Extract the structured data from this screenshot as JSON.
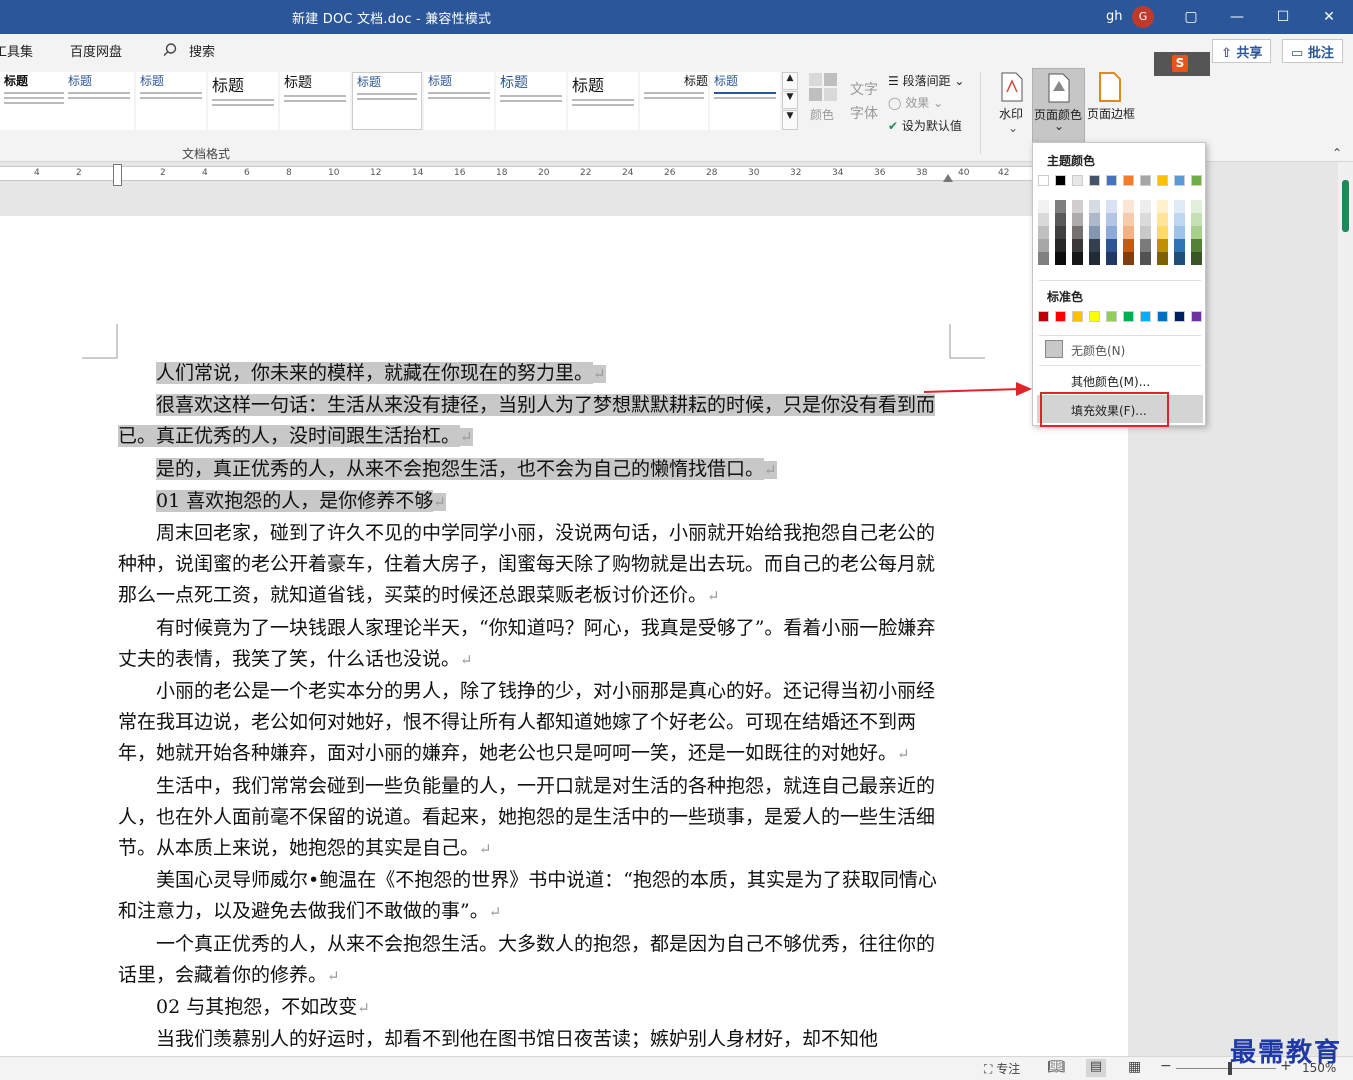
{
  "titlebar": {
    "title": "新建 DOC 文档.doc  -  兼容性模式",
    "user": "gh",
    "avatar_letter": "G",
    "controls": [
      "▢",
      "—",
      "☐",
      "✕"
    ]
  },
  "tabs": [
    "工具集",
    "百度网盘",
    "搜索"
  ],
  "share": {
    "share_label": "共享",
    "comment_label": "批注"
  },
  "ribbon": {
    "gallery": [
      "标题",
      "标题",
      "标题",
      "标题",
      "标题",
      "标题",
      "标题",
      "标题",
      "标题",
      "标题",
      "标题",
      "标题"
    ],
    "group_label": "文档格式",
    "colors_label": "颜色",
    "fonts_label": "文字\n字体",
    "para_spacing": "段落间距",
    "effects": "效果",
    "set_default": "设为默认值",
    "watermark": "水印",
    "page_color": "页面颜色",
    "page_border": "页面边框"
  },
  "ruler": {
    "ticks": [
      "4",
      "2",
      "2",
      "4",
      "6",
      "8",
      "10",
      "12",
      "14",
      "16",
      "18",
      "20",
      "22",
      "24",
      "26",
      "28",
      "30",
      "32",
      "34",
      "36",
      "38",
      "40",
      "42"
    ]
  },
  "document": {
    "paragraphs": [
      {
        "text": "人们常说，你未来的模样，就藏在你现在的努力里。",
        "hl": true
      },
      {
        "text": "很喜欢这样一句话：生活从来没有捷径，当别人为了梦想默默耕耘的时候，只是你没有看到而已。真正优秀的人，没时间跟生活抬杠。",
        "hl": true
      },
      {
        "text": "是的，真正优秀的人，从来不会抱怨生活，也不会为自己的懒惰找借口。",
        "hl": true
      },
      {
        "text": "01  喜欢抱怨的人，是你修养不够",
        "hl": true
      },
      {
        "text": "周末回老家，碰到了许久不见的中学同学小丽，没说两句话，小丽就开始给我抱怨自己老公的种种，说闺蜜的老公开着豪车，住着大房子，闺蜜每天除了购物就是出去玩。而自己的老公每月就那么一点死工资，就知道省钱，买菜的时候还总跟菜贩老板讨价还价。",
        "hl": false
      },
      {
        "text": "有时候竟为了一块钱跟人家理论半天，“你知道吗？阿心，我真是受够了”。看着小丽一脸嫌弃丈夫的表情，我笑了笑，什么话也没说。",
        "hl": false
      },
      {
        "text": "小丽的老公是一个老实本分的男人，除了钱挣的少，对小丽那是真心的好。还记得当初小丽经常在我耳边说，老公如何对她好，恨不得让所有人都知道她嫁了个好老公。可现在结婚还不到两年，她就开始各种嫌弃，面对小丽的嫌弃，她老公也只是呵呵一笑，还是一如既往的对她好。",
        "hl": false
      },
      {
        "text": "生活中，我们常常会碰到一些负能量的人，一开口就是对生活的各种抱怨，就连自己最亲近的人，也在外人面前毫不保留的说道。看起来，她抱怨的是生活中的一些琐事，是爱人的一些生活细节。从本质上来说，她抱怨的其实是自己。",
        "hl": false
      },
      {
        "text": "美国心灵导师威尔•鲍温在《不抱怨的世界》书中说道：“抱怨的本质，其实是为了获取同情心和注意力，以及避免去做我们不敢做的事”。",
        "hl": false
      },
      {
        "text": "一个真正优秀的人，从来不会抱怨生活。大多数人的抱怨，都是因为自己不够优秀，往往你的话里，会藏着你的修养。",
        "hl": false
      },
      {
        "text": "02  与其抱怨，不如改变",
        "hl": false
      },
      {
        "text": "当我们羡慕别人的好运时，却看不到他在图书馆日夜苦读；嫉妒别人身材好，却不知他",
        "hl": false
      }
    ],
    "return_mark": "↵"
  },
  "dropdown": {
    "theme_colors_label": "主题颜色",
    "standard_colors_label": "标准色",
    "no_color": "无颜色(N)",
    "more_colors": "其他颜色(M)...",
    "fill_effects": "填充效果(F)...",
    "theme_top": [
      "#ffffff",
      "#000000",
      "#e7e6e6",
      "#44546a",
      "#4472c4",
      "#ed7d31",
      "#a5a5a5",
      "#ffc000",
      "#5b9bd5",
      "#70ad47"
    ],
    "theme_shades": [
      [
        "#f2f2f2",
        "#d9d9d9",
        "#bfbfbf",
        "#a6a6a6",
        "#808080"
      ],
      [
        "#7f7f7f",
        "#595959",
        "#404040",
        "#262626",
        "#0d0d0d"
      ],
      [
        "#d0cece",
        "#aeabab",
        "#757171",
        "#3a3838",
        "#171616"
      ],
      [
        "#d6dce4",
        "#adb9ca",
        "#8496b0",
        "#333f4f",
        "#222a35"
      ],
      [
        "#d9e2f3",
        "#b4c6e7",
        "#8eaadb",
        "#2f5496",
        "#1f3864"
      ],
      [
        "#fbe5d5",
        "#f7cbac",
        "#f4b183",
        "#c55a11",
        "#833c0b"
      ],
      [
        "#ededed",
        "#dbdbdb",
        "#c9c9c9",
        "#7b7b7b",
        "#525252"
      ],
      [
        "#fff2cc",
        "#fee599",
        "#ffd965",
        "#bf9000",
        "#7f6000"
      ],
      [
        "#deebf6",
        "#bdd7ee",
        "#9dc3e6",
        "#2e75b5",
        "#1f4e79"
      ],
      [
        "#e2efd9",
        "#c5e0b3",
        "#a8d08d",
        "#538135",
        "#375623"
      ]
    ],
    "standard": [
      "#c00000",
      "#ff0000",
      "#ffc000",
      "#ffff00",
      "#92d050",
      "#00b050",
      "#00b0f0",
      "#0070c0",
      "#002060",
      "#7030a0"
    ]
  },
  "statusbar": {
    "focus": "专注",
    "zoom": "150%"
  },
  "watermark_text": "最需教育"
}
